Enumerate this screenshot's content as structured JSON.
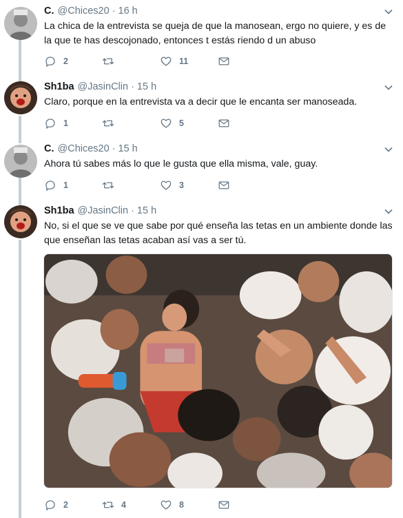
{
  "tweets": [
    {
      "name": "C.",
      "handle": "@Chices20",
      "time": "16 h",
      "text": "La chica de la entrevista se queja de que la manosean, ergo no quiere, y es de la que te has descojonado, entonces t estás riendo d un abuso",
      "replies": "2",
      "retweets": "",
      "likes": "11"
    },
    {
      "name": "Sh1ba",
      "handle": "@JasinClin",
      "time": "15 h",
      "text": "Claro, porque en la entrevista va a decir que le encanta ser manoseada.",
      "replies": "1",
      "retweets": "",
      "likes": "5"
    },
    {
      "name": "C.",
      "handle": "@Chices20",
      "time": "15 h",
      "text": "Ahora tú sabes más lo que le gusta que ella misma, vale, guay.",
      "replies": "1",
      "retweets": "",
      "likes": "3"
    },
    {
      "name": "Sh1ba",
      "handle": "@JasinClin",
      "time": "15 h",
      "text": "No, si el que se ve que sabe por qué enseña las tetas en un ambiente donde las que enseñan las tetas acaban así vas a ser tú.",
      "replies": "2",
      "retweets": "4",
      "likes": "8"
    }
  ],
  "icons": {
    "reply": "reply-icon",
    "retweet": "retweet-icon",
    "like": "heart-icon",
    "dm": "envelope-icon",
    "caret": "chevron-down-icon"
  },
  "colors": {
    "text": "#14171a",
    "muted": "#657786",
    "thread_line": "#c4cfd6",
    "background": "#ffffff"
  }
}
